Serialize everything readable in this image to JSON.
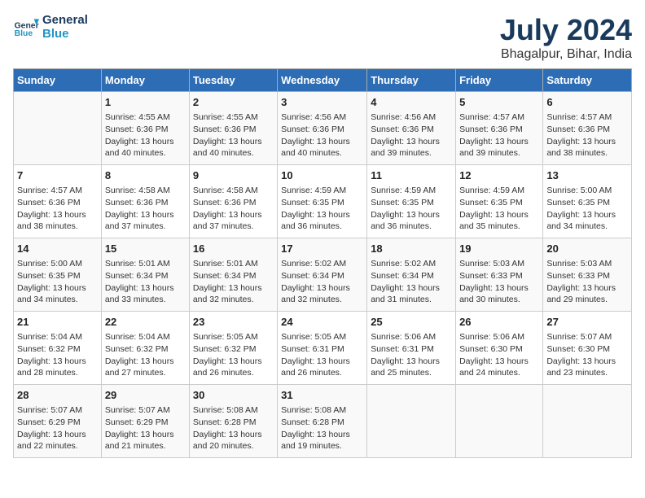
{
  "header": {
    "logo_line1": "General",
    "logo_line2": "Blue",
    "month_title": "July 2024",
    "location": "Bhagalpur, Bihar, India"
  },
  "weekdays": [
    "Sunday",
    "Monday",
    "Tuesday",
    "Wednesday",
    "Thursday",
    "Friday",
    "Saturday"
  ],
  "weeks": [
    [
      {
        "day": "",
        "info": ""
      },
      {
        "day": "1",
        "info": "Sunrise: 4:55 AM\nSunset: 6:36 PM\nDaylight: 13 hours\nand 40 minutes."
      },
      {
        "day": "2",
        "info": "Sunrise: 4:55 AM\nSunset: 6:36 PM\nDaylight: 13 hours\nand 40 minutes."
      },
      {
        "day": "3",
        "info": "Sunrise: 4:56 AM\nSunset: 6:36 PM\nDaylight: 13 hours\nand 40 minutes."
      },
      {
        "day": "4",
        "info": "Sunrise: 4:56 AM\nSunset: 6:36 PM\nDaylight: 13 hours\nand 39 minutes."
      },
      {
        "day": "5",
        "info": "Sunrise: 4:57 AM\nSunset: 6:36 PM\nDaylight: 13 hours\nand 39 minutes."
      },
      {
        "day": "6",
        "info": "Sunrise: 4:57 AM\nSunset: 6:36 PM\nDaylight: 13 hours\nand 38 minutes."
      }
    ],
    [
      {
        "day": "7",
        "info": "Sunrise: 4:57 AM\nSunset: 6:36 PM\nDaylight: 13 hours\nand 38 minutes."
      },
      {
        "day": "8",
        "info": "Sunrise: 4:58 AM\nSunset: 6:36 PM\nDaylight: 13 hours\nand 37 minutes."
      },
      {
        "day": "9",
        "info": "Sunrise: 4:58 AM\nSunset: 6:36 PM\nDaylight: 13 hours\nand 37 minutes."
      },
      {
        "day": "10",
        "info": "Sunrise: 4:59 AM\nSunset: 6:35 PM\nDaylight: 13 hours\nand 36 minutes."
      },
      {
        "day": "11",
        "info": "Sunrise: 4:59 AM\nSunset: 6:35 PM\nDaylight: 13 hours\nand 36 minutes."
      },
      {
        "day": "12",
        "info": "Sunrise: 4:59 AM\nSunset: 6:35 PM\nDaylight: 13 hours\nand 35 minutes."
      },
      {
        "day": "13",
        "info": "Sunrise: 5:00 AM\nSunset: 6:35 PM\nDaylight: 13 hours\nand 34 minutes."
      }
    ],
    [
      {
        "day": "14",
        "info": "Sunrise: 5:00 AM\nSunset: 6:35 PM\nDaylight: 13 hours\nand 34 minutes."
      },
      {
        "day": "15",
        "info": "Sunrise: 5:01 AM\nSunset: 6:34 PM\nDaylight: 13 hours\nand 33 minutes."
      },
      {
        "day": "16",
        "info": "Sunrise: 5:01 AM\nSunset: 6:34 PM\nDaylight: 13 hours\nand 32 minutes."
      },
      {
        "day": "17",
        "info": "Sunrise: 5:02 AM\nSunset: 6:34 PM\nDaylight: 13 hours\nand 32 minutes."
      },
      {
        "day": "18",
        "info": "Sunrise: 5:02 AM\nSunset: 6:34 PM\nDaylight: 13 hours\nand 31 minutes."
      },
      {
        "day": "19",
        "info": "Sunrise: 5:03 AM\nSunset: 6:33 PM\nDaylight: 13 hours\nand 30 minutes."
      },
      {
        "day": "20",
        "info": "Sunrise: 5:03 AM\nSunset: 6:33 PM\nDaylight: 13 hours\nand 29 minutes."
      }
    ],
    [
      {
        "day": "21",
        "info": "Sunrise: 5:04 AM\nSunset: 6:32 PM\nDaylight: 13 hours\nand 28 minutes."
      },
      {
        "day": "22",
        "info": "Sunrise: 5:04 AM\nSunset: 6:32 PM\nDaylight: 13 hours\nand 27 minutes."
      },
      {
        "day": "23",
        "info": "Sunrise: 5:05 AM\nSunset: 6:32 PM\nDaylight: 13 hours\nand 26 minutes."
      },
      {
        "day": "24",
        "info": "Sunrise: 5:05 AM\nSunset: 6:31 PM\nDaylight: 13 hours\nand 26 minutes."
      },
      {
        "day": "25",
        "info": "Sunrise: 5:06 AM\nSunset: 6:31 PM\nDaylight: 13 hours\nand 25 minutes."
      },
      {
        "day": "26",
        "info": "Sunrise: 5:06 AM\nSunset: 6:30 PM\nDaylight: 13 hours\nand 24 minutes."
      },
      {
        "day": "27",
        "info": "Sunrise: 5:07 AM\nSunset: 6:30 PM\nDaylight: 13 hours\nand 23 minutes."
      }
    ],
    [
      {
        "day": "28",
        "info": "Sunrise: 5:07 AM\nSunset: 6:29 PM\nDaylight: 13 hours\nand 22 minutes."
      },
      {
        "day": "29",
        "info": "Sunrise: 5:07 AM\nSunset: 6:29 PM\nDaylight: 13 hours\nand 21 minutes."
      },
      {
        "day": "30",
        "info": "Sunrise: 5:08 AM\nSunset: 6:28 PM\nDaylight: 13 hours\nand 20 minutes."
      },
      {
        "day": "31",
        "info": "Sunrise: 5:08 AM\nSunset: 6:28 PM\nDaylight: 13 hours\nand 19 minutes."
      },
      {
        "day": "",
        "info": ""
      },
      {
        "day": "",
        "info": ""
      },
      {
        "day": "",
        "info": ""
      }
    ]
  ]
}
